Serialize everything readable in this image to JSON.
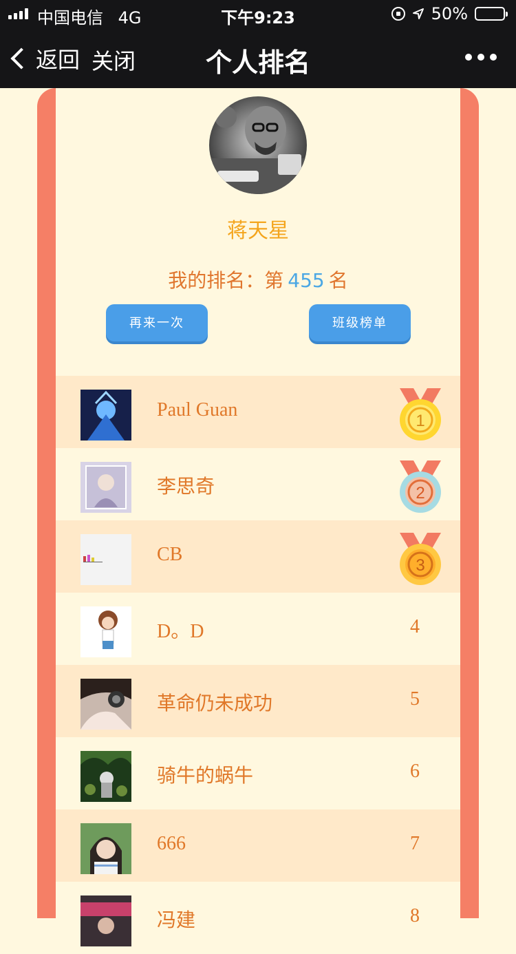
{
  "status": {
    "carrier": "中国电信",
    "network": "4G",
    "time": "下午9:23",
    "battery": "50%",
    "battery_level": 0.5
  },
  "nav": {
    "back_label": "返回",
    "close_label": "关闭",
    "title": "个人排名"
  },
  "profile": {
    "name": "蒋天星",
    "rank_prefix": "我的排名：第",
    "rank_value": "455",
    "rank_suffix": "名"
  },
  "buttons": {
    "retry": "再来一次",
    "class_board": "班级榜单"
  },
  "ranking": [
    {
      "name": "Paul Guan",
      "rank": "1",
      "medal": "gold-medal-icon"
    },
    {
      "name": "李思奇",
      "rank": "2",
      "medal": "silver-medal-icon"
    },
    {
      "name": "CB",
      "rank": "3",
      "medal": "bronze-medal-icon"
    },
    {
      "name": "D。D",
      "rank": "4"
    },
    {
      "name": "革命仍未成功",
      "rank": "5"
    },
    {
      "name": "骑牛的蜗牛",
      "rank": "6"
    },
    {
      "name": "666",
      "rank": "7"
    },
    {
      "name": "冯建",
      "rank": "8"
    }
  ],
  "colors": {
    "nav_bg": "#151517",
    "page_bg": "#fff8df",
    "row_alt_bg": "#ffe9c9",
    "frame": "#f57f66",
    "name_text": "#e07829",
    "username": "#f4a51d",
    "rank_number": "#4ba7e4",
    "button": "#4a9ee8"
  }
}
